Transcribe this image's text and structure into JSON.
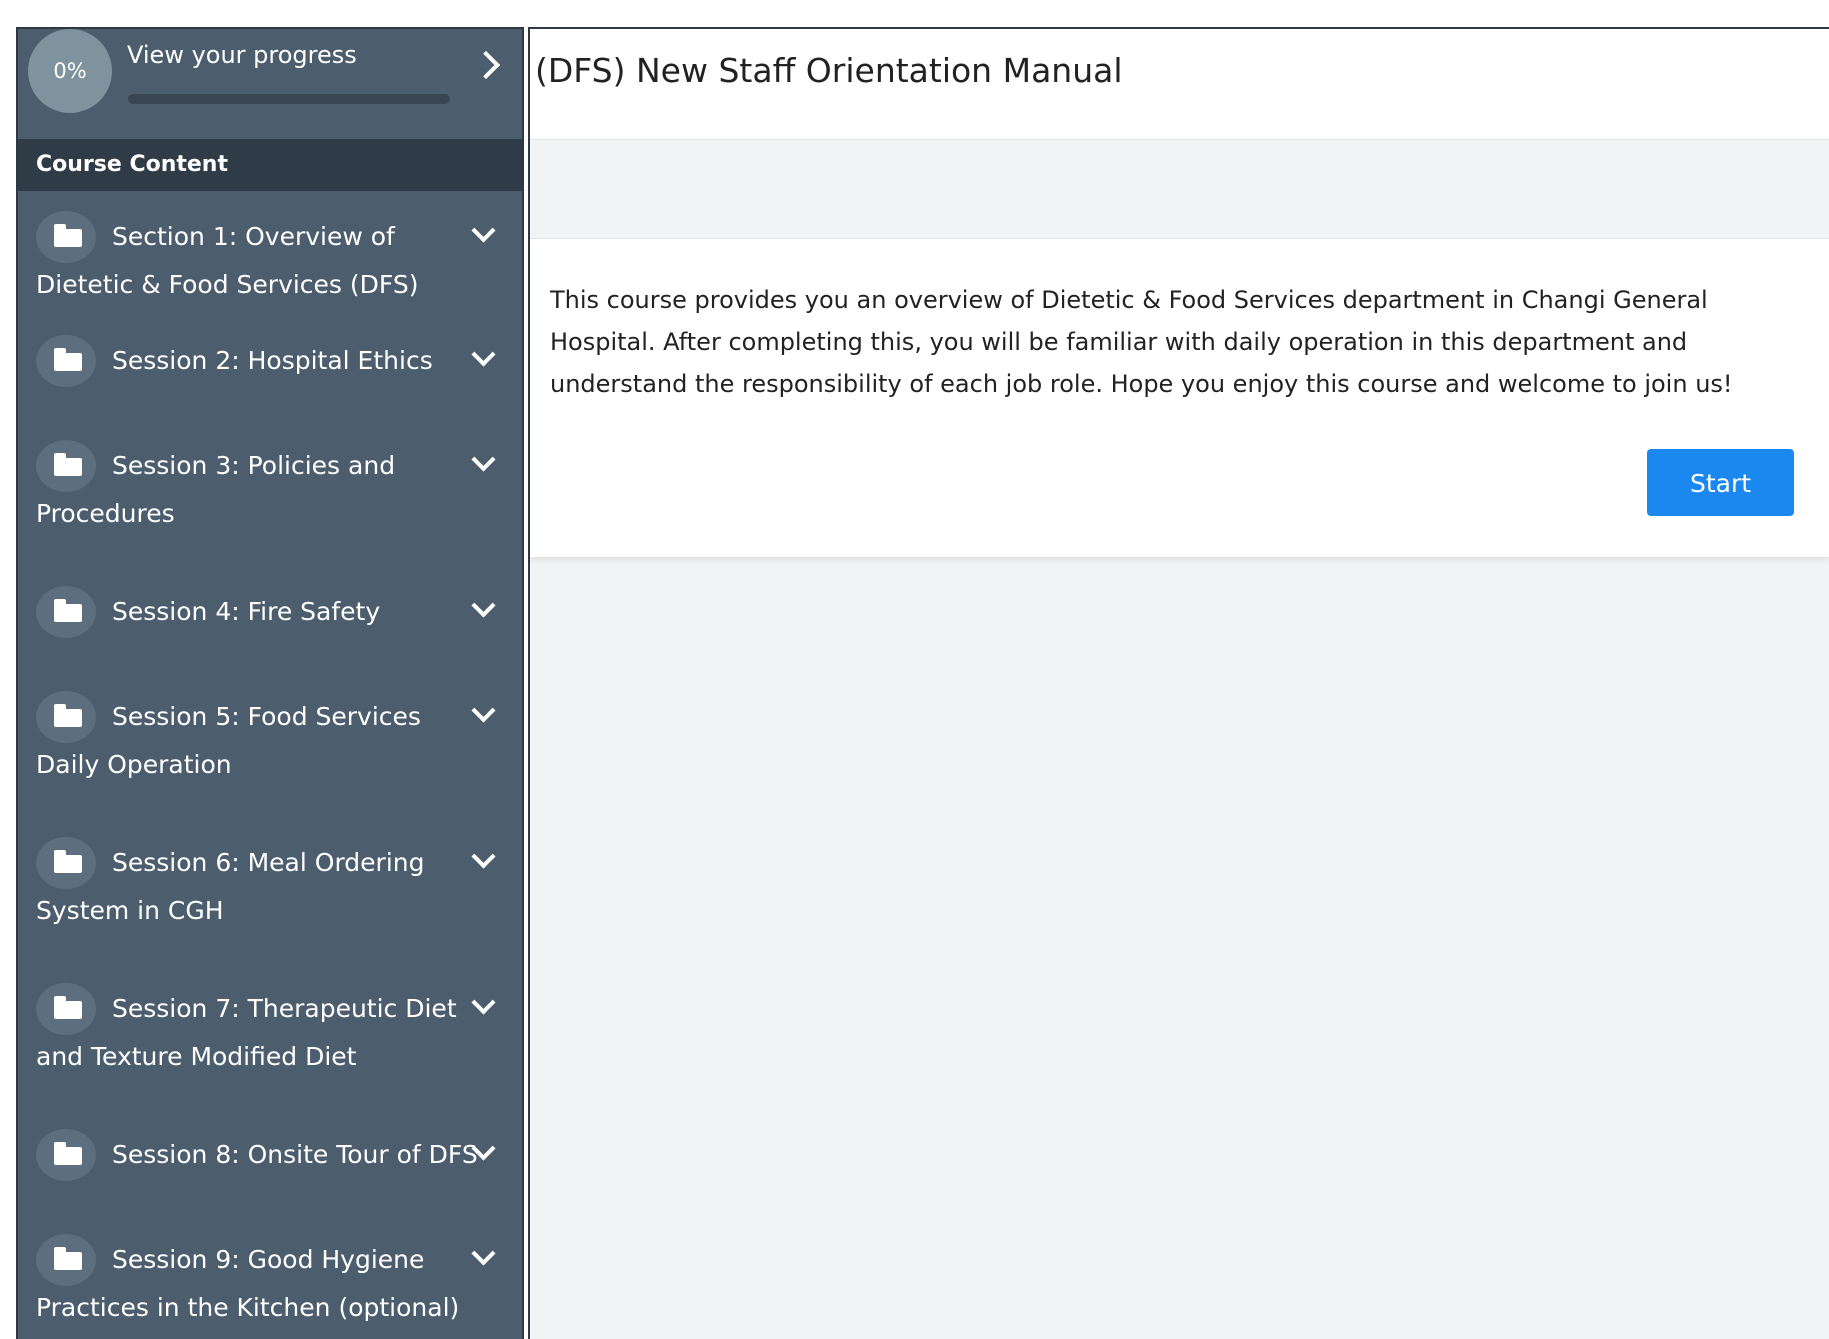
{
  "sidebar": {
    "progress": {
      "percent_label": "0%",
      "percent_value": 0,
      "label": "View your progress"
    },
    "course_content_label": "Course Content",
    "sections": [
      {
        "title": "Section 1: Overview of Dietetic & Food Services (DFS)",
        "icon": "folder-icon"
      },
      {
        "title": "Session 2: Hospital Ethics",
        "icon": "folder-icon"
      },
      {
        "title": "Session 3: Policies and Procedures",
        "icon": "folder-icon"
      },
      {
        "title": "Session 4: Fire Safety",
        "icon": "folder-icon"
      },
      {
        "title": "Session 5: Food Services Daily Operation",
        "icon": "folder-icon"
      },
      {
        "title": "Session 6: Meal Ordering System in CGH",
        "icon": "folder-icon"
      },
      {
        "title": "Session 7: Therapeutic Diet and Texture Modified Diet",
        "icon": "folder-icon"
      },
      {
        "title": "Session 8: Onsite Tour of DFS",
        "icon": "folder-icon"
      },
      {
        "title": "Session 9: Good Hygiene Practices in the Kitchen (optional)",
        "icon": "folder-icon"
      }
    ]
  },
  "main": {
    "title": "(DFS) New Staff Orientation Manual",
    "description": "This course provides you an overview of Dietetic & Food Services department in Changi General Hospital. After completing this, you will be familiar with daily operation in this department and understand the responsibility of each job role. Hope you enjoy this course and welcome to join us!",
    "start_label": "Start"
  },
  "colors": {
    "sidebar_bg": "#4c5d6e",
    "course_content_bg": "#2f3b47",
    "start_button": "#1a88ee",
    "progress_circle": "#7e939d"
  }
}
